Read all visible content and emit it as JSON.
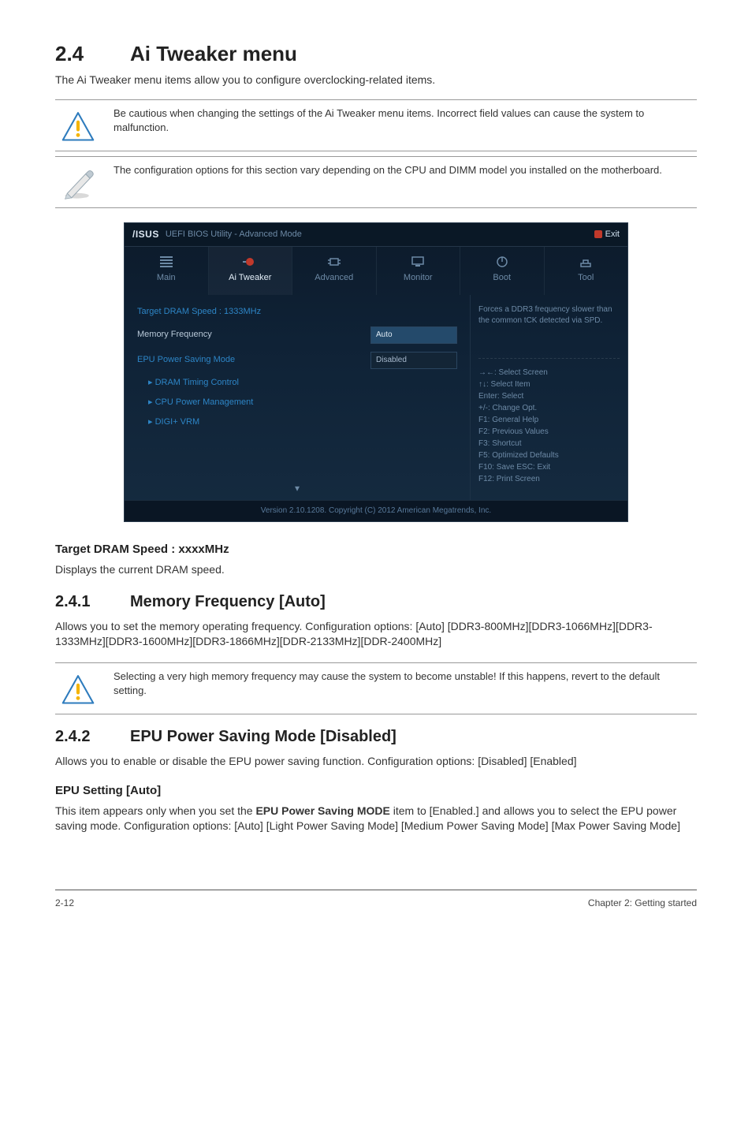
{
  "section": {
    "number": "2.4",
    "title": "Ai Tweaker menu",
    "lead": "The Ai Tweaker menu items allow you to configure overclocking-related items."
  },
  "callouts": {
    "caution1": "Be cautious when changing the settings of the Ai Tweaker menu items. Incorrect field values can cause the system to malfunction.",
    "note1": "The configuration options for this section vary depending on the CPU and DIMM model you installed on the motherboard."
  },
  "bios": {
    "brand": "/ISUS",
    "title": "UEFI BIOS Utility - Advanced Mode",
    "exit": "Exit",
    "tabs": {
      "main": "Main",
      "tweaker": "Ai Tweaker",
      "advanced": "Advanced",
      "monitor": "Monitor",
      "boot": "Boot",
      "tool": "Tool"
    },
    "rows": {
      "target_dram": {
        "label": "Target DRAM Speed : 1333MHz"
      },
      "mem_freq": {
        "label": "Memory Frequency",
        "value": "Auto"
      },
      "epu_mode": {
        "label": "EPU Power Saving Mode",
        "value": "Disabled"
      },
      "dram_timing": {
        "label": "DRAM Timing Control"
      },
      "cpu_pm": {
        "label": "CPU Power Management"
      },
      "digi": {
        "label": "DIGI+ VRM"
      }
    },
    "help_top": "Forces a DDR3 frequency slower than the common tCK detected via SPD.",
    "keys": {
      "k1": "→←: Select Screen",
      "k2": "↑↓: Select Item",
      "k3": "Enter: Select",
      "k4": "+/-: Change Opt.",
      "k5": "F1: General Help",
      "k6": "F2: Previous Values",
      "k7": "F3: Shortcut",
      "k8": "F5: Optimized Defaults",
      "k9": "F10: Save  ESC: Exit",
      "k10": "F12: Print Screen"
    },
    "footer": "Version 2.10.1208. Copyright (C) 2012 American Megatrends, Inc."
  },
  "target_dram": {
    "heading": "Target DRAM Speed : xxxxMHz",
    "body": "Displays the current DRAM speed."
  },
  "sub241": {
    "number": "2.4.1",
    "title": "Memory Frequency [Auto]",
    "body": "Allows you to set the memory operating frequency. Configuration options: [Auto] [DDR3-800MHz][DDR3-1066MHz][DDR3-1333MHz][DDR3-1600MHz][DDR3-1866MHz][DDR-2133MHz][DDR-2400MHz]"
  },
  "callouts2": {
    "caution2": "Selecting a very high memory frequency may cause the system to become unstable! If this happens, revert to the default setting."
  },
  "sub242": {
    "number": "2.4.2",
    "title": "EPU Power Saving Mode [Disabled]",
    "body": "Allows you to enable or disable the EPU power saving function. Configuration options: [Disabled] [Enabled]",
    "sub_heading": "EPU Setting [Auto]",
    "sub_body_pre": "This item appears only when you set the ",
    "sub_body_bold": "EPU Power Saving MODE",
    "sub_body_post": " item to [Enabled.] and allows you to select the EPU power saving mode. Configuration options: [Auto] [Light Power Saving Mode] [Medium Power Saving Mode] [Max Power Saving Mode]"
  },
  "footer": {
    "page": "2-12",
    "chapter": "Chapter 2: Getting started"
  }
}
